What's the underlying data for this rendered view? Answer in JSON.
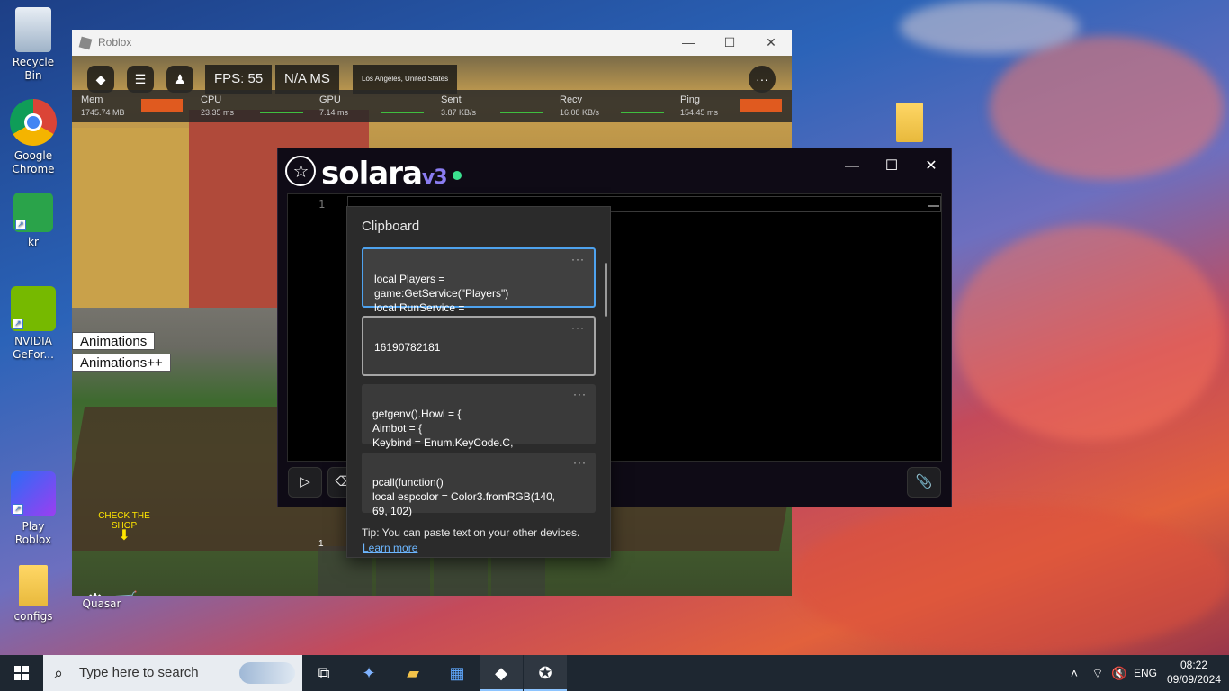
{
  "desktop": {
    "icons": [
      {
        "label": "Recycle Bin"
      },
      {
        "label": "Google Chrome"
      },
      {
        "label": "kr"
      },
      {
        "label": "NVIDIA GeFor..."
      },
      {
        "label": "Play Roblox"
      },
      {
        "label": "configs"
      },
      {
        "label": "Quasar"
      }
    ]
  },
  "roblox": {
    "title": "Roblox",
    "fps": "FPS: 55",
    "ms": "N/A MS",
    "location": "Los Angeles, United States",
    "perf": {
      "mem_label": "Mem",
      "mem_value": "1745.74 MB",
      "cpu_label": "CPU",
      "cpu_value": "23.35 ms",
      "gpu_label": "GPU",
      "gpu_value": "7.14 ms",
      "sent_label": "Sent",
      "sent_value": "3.87 KB/s",
      "recv_label": "Recv",
      "recv_value": "16.08 KB/s",
      "ping_label": "Ping",
      "ping_value": "154.45 ms"
    },
    "animations_label": "Animations",
    "animations_plus_label": "Animations++",
    "shop_hint": "CHECK THE SHOP",
    "hotbar_slot_number": "1"
  },
  "solara": {
    "logo_text": "solara",
    "logo_version": "v3",
    "line_number": "1",
    "win_min": "—",
    "win_max": "☐",
    "win_close": "✕"
  },
  "clipboard": {
    "title": "Clipboard",
    "items": [
      {
        "text": "local Players =\ngame:GetService(\"Players\")\nlocal RunService ="
      },
      {
        "text": "16190782181"
      },
      {
        "text": "getgenv().Howl = {\nAimbot = {\nKeybind = Enum.KeyCode.C,"
      },
      {
        "text": "pcall(function()\nlocal espcolor = Color3.fromRGB(140,\n69, 102)"
      }
    ],
    "more_label": "···",
    "tip": "Tip: You can paste text on your other devices.",
    "learn_more": "Learn more"
  },
  "taskbar": {
    "search_placeholder": "Type here to search",
    "language": "ENG",
    "time": "08:22",
    "date": "09/09/2024"
  }
}
